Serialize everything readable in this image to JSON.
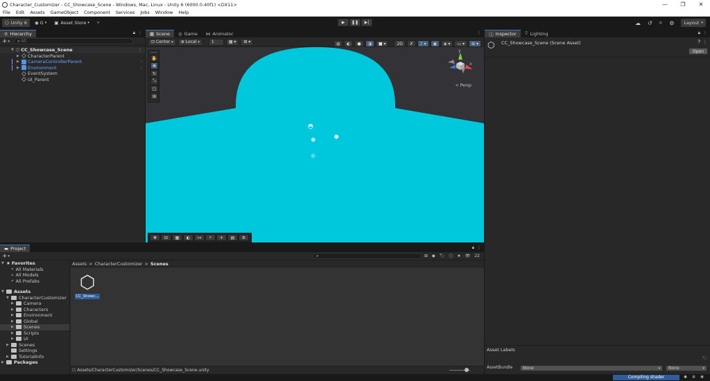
{
  "window": {
    "title": "Character_Customizer - CC_Showcase_Scene - Windows, Mac, Linux - Unity 6 (6000.0.40f1) <DX11>",
    "controls": [
      "—",
      "❐",
      "✕"
    ]
  },
  "menu": [
    "File",
    "Edit",
    "Assets",
    "GameObject",
    "Component",
    "Services",
    "Jobs",
    "Window",
    "Help"
  ],
  "toolbar": {
    "unity_label": "Unity 6",
    "account_label": "G",
    "asset_store_label": "Asset Store",
    "layout_label": "Layout"
  },
  "hierarchy": {
    "tab": "Hierarchy",
    "search_placeholder": "All",
    "scene": "CC_Showcase_Scene",
    "items": [
      {
        "label": "CharacterParent",
        "prefab": false
      },
      {
        "label": "CameraControllerParent",
        "prefab": true
      },
      {
        "label": "Environment",
        "prefab": true
      },
      {
        "label": "EventSystem",
        "prefab": false
      },
      {
        "label": "UI_Parent",
        "prefab": false
      }
    ]
  },
  "scene_view": {
    "tabs": [
      "Scene",
      "Game",
      "Animator"
    ],
    "pivot": "Center",
    "space": "Local",
    "grid_value": "1",
    "persp_label": "< Persp",
    "gizmo_y": "y",
    "gizmo_x": "x",
    "sky_color": "#323237",
    "ground_color": "#00c8dc"
  },
  "inspector": {
    "tabs": [
      "Inspector",
      "Lighting"
    ],
    "asset_name": "CC_Showcase_Scene (Scene Asset)",
    "open_label": "Open",
    "asset_labels": "Asset Labels",
    "asset_bundle_label": "AssetBundle",
    "bundle_value": "None",
    "variant_value": "None"
  },
  "project": {
    "tab": "Project",
    "badge_count": "22",
    "breadcrumb": [
      "Assets",
      "CharacterCustomizer",
      "Scenes"
    ],
    "favorites": {
      "title": "Favorites",
      "items": [
        "All Materials",
        "All Models",
        "All Prefabs"
      ]
    },
    "assets": {
      "title": "Assets",
      "root": "CharacterCustomizer",
      "children": [
        "Camera",
        "Characters",
        "Environment",
        "Global",
        "Scenes",
        "Scripts",
        "UI"
      ],
      "siblings": [
        "Scenes",
        "Settings",
        "TutorialInfo"
      ]
    },
    "packages": "Packages",
    "file_label": "CC_Showc...",
    "status_path": "Assets/CharacterCustomizer/Scenes/CC_Showcase_Scene.unity"
  },
  "statusbar": {
    "progress_label": "Compiling shader"
  }
}
